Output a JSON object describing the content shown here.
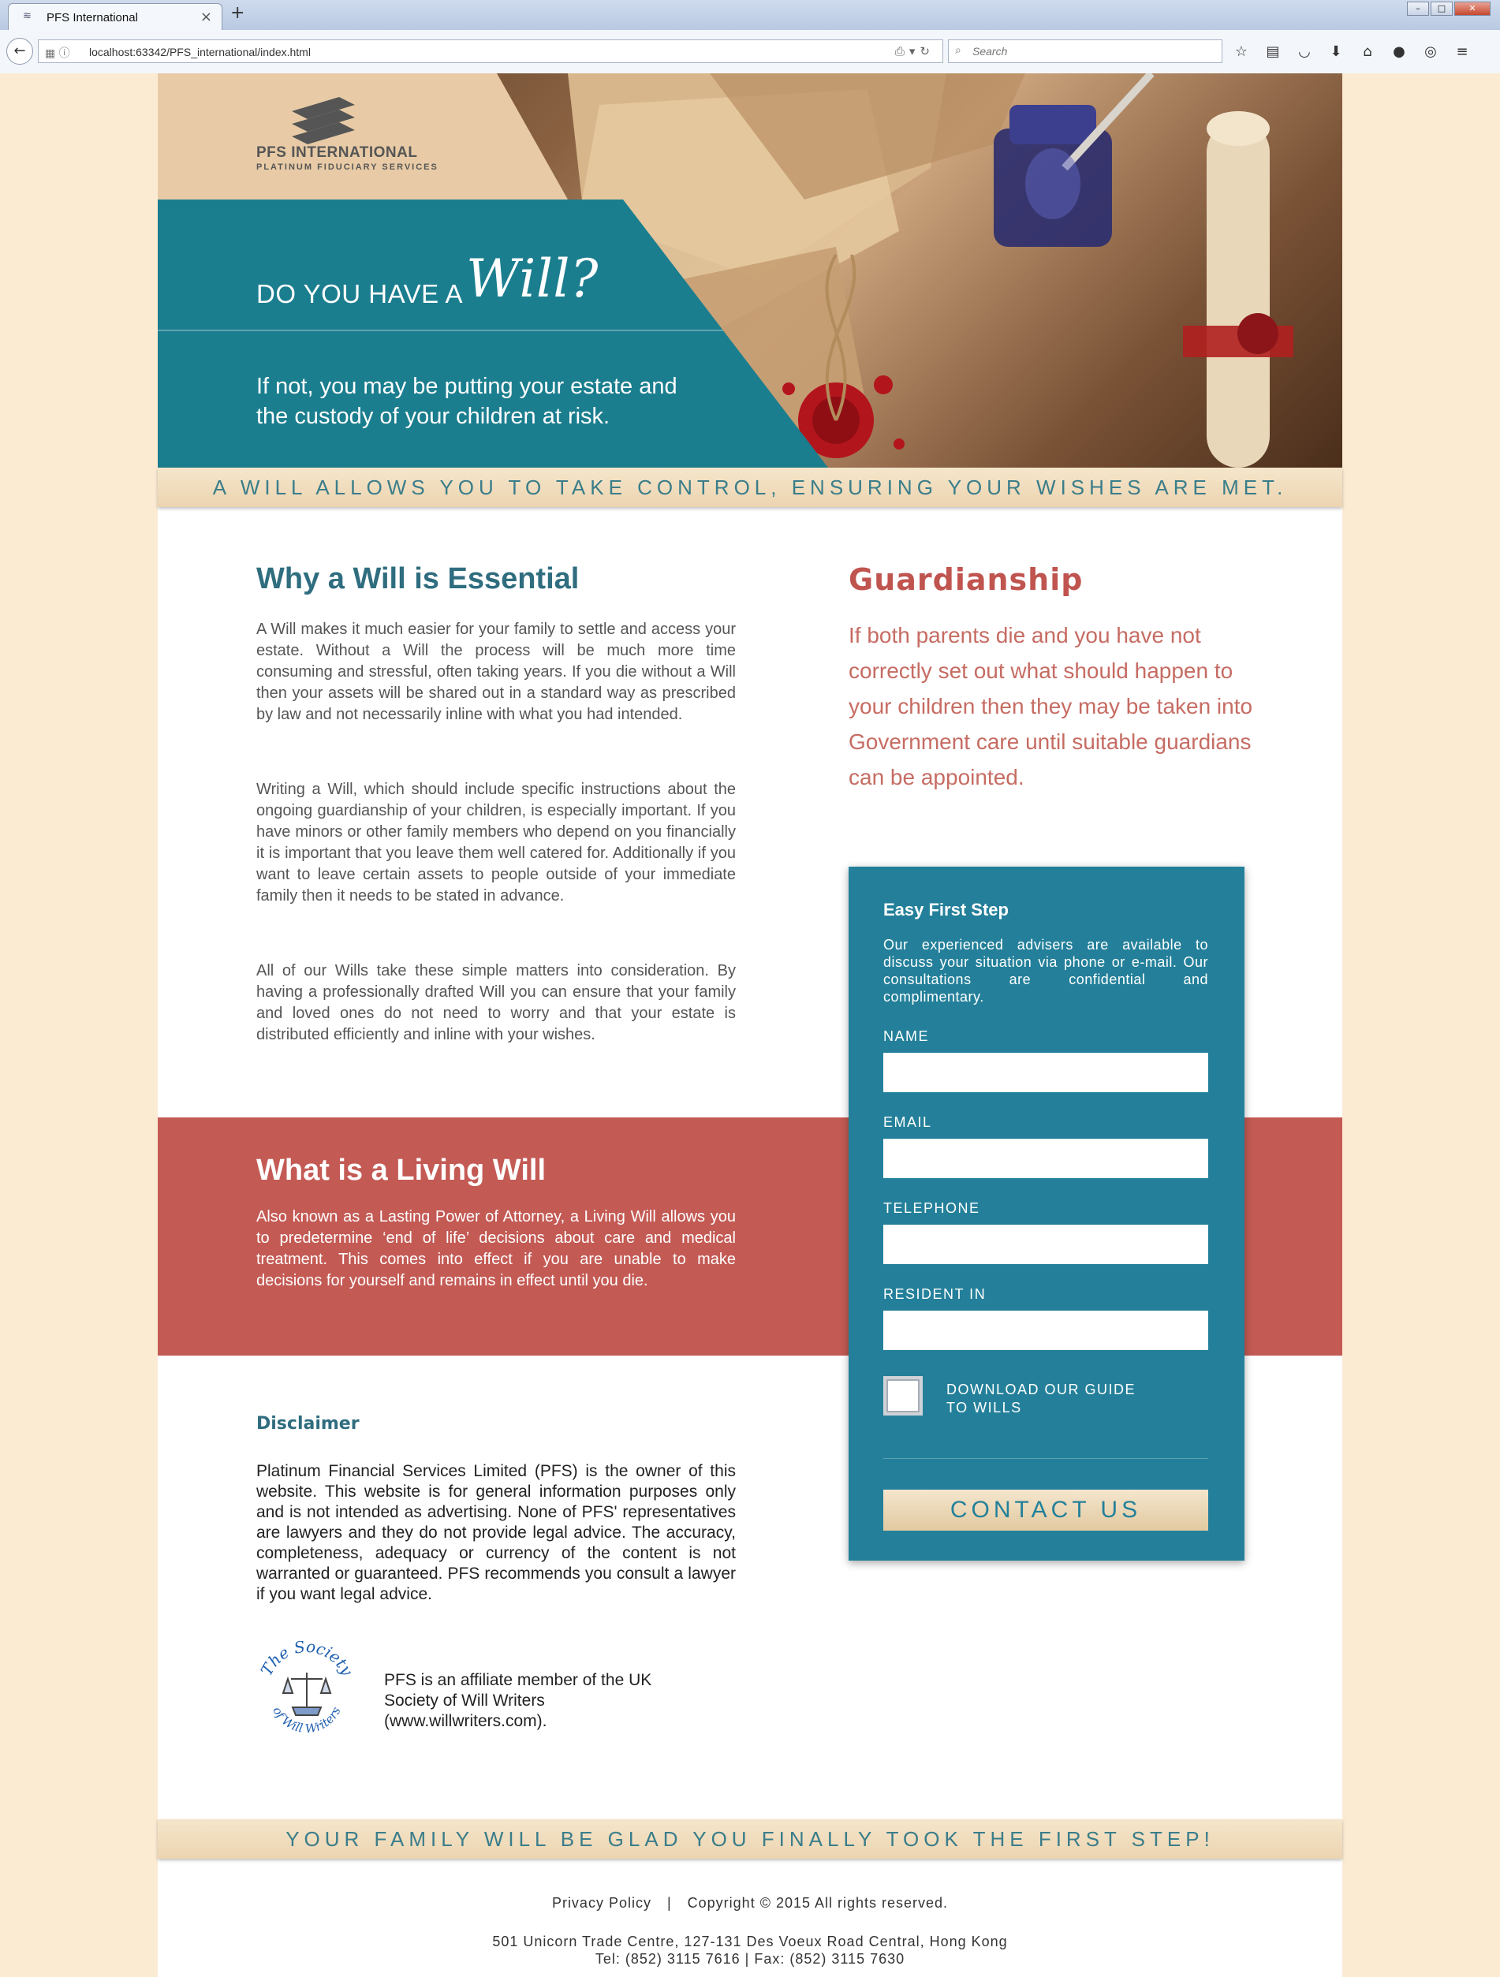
{
  "browser": {
    "tab_title": "PFS International",
    "url": "localhost:63342/PFS_international/index.html",
    "search_placeholder": "Search"
  },
  "hero": {
    "logo_line1": "PFS INTERNATIONAL",
    "logo_line2": "PLATINUM FIDUCIARY SERVICES",
    "question_prefix": "DO YOU HAVE A",
    "question_word": "Will?",
    "subtitle": "If not, you may be putting your estate and the custody of your children at risk."
  },
  "ribbon_top": "A WILL ALLOWS YOU TO TAKE CONTROL, ENSURING YOUR WISHES ARE MET.",
  "why": {
    "title": "Why a Will is Essential",
    "p1": "A Will makes it much easier for your family to settle and access your estate. Without a Will the process will be much more time consuming and stressful, often taking years. If you die without a Will then your assets will be shared out in a standard way as prescribed by law and not necessarily inline with what you had intended.",
    "p2": "Writing a Will, which should include specific instructions about the ongoing guardianship of your children, is especially important. If you have minors or other family members who depend on you financially it is important that you leave them well catered for. Additionally if you want to leave certain assets to people outside of your immediate family then it needs to be stated in advance.",
    "p3": "All of our Wills take these simple matters into consideration. By having a professionally drafted Will you can ensure that your family and loved ones do not need to worry and that your estate is distributed efficiently and inline with your wishes."
  },
  "guardianship": {
    "title": "Guardianship",
    "text": "If both parents die and you have not correctly set out what should happen to your children then they may be taken into Government care until suitable guardians can be appointed."
  },
  "living_will": {
    "title": "What is a Living Will",
    "text": "Also known as a Lasting Power of Attorney, a Living Will allows you to predetermine ‘end of life’ decisions about care and medical treatment. This comes into effect if you are unable to make decisions for yourself and remains in effect until you die."
  },
  "disclaimer": {
    "title": "Disclaimer",
    "text": "Platinum Financial Services Limited (PFS) is the owner of this website. This website is for general information purposes only and is not intended as advertising. None of PFS' representatives are lawyers and they do not provide legal advice. The accuracy, completeness, adequacy or currency of the content is not warranted or guaranteed. PFS recommends you consult a lawyer if you want legal advice."
  },
  "society": {
    "logo_text_top": "The Society",
    "logo_text_bottom": "of Will Writers",
    "text": "PFS is an affiliate member of the UK Society of Will Writers (www.willwriters.com)."
  },
  "form": {
    "title": "Easy First Step",
    "intro": "Our experienced advisers are available to discuss your situation via phone or e-mail. Our consultations are confidential and complimentary.",
    "name_label": "NAME",
    "email_label": "EMAIL",
    "telephone_label": "TELEPHONE",
    "resident_label": "RESIDENT IN",
    "name_value": "",
    "email_value": "",
    "telephone_value": "",
    "resident_value": "",
    "checkbox_label": "DOWNLOAD OUR GUIDE TO WILLS",
    "checkbox_checked": false,
    "submit_label": "CONTACT US"
  },
  "ribbon_bottom": "YOUR FAMILY WILL BE GLAD YOU FINALLY TOOK THE FIRST STEP!",
  "footer": {
    "privacy_label": "Privacy Policy",
    "separator": "|",
    "copyright": "Copyright © 2015 All rights reserved.",
    "address": "501 Unicorn Trade Centre, 127-131 Des Voeux Road Central, Hong Kong",
    "contact": "Tel: (852) 3115 7616 | Fax: (852) 3115 7630"
  },
  "colors": {
    "page_background": "#fcebd3",
    "teal": "#24809a",
    "heading_teal": "#2f6d7f",
    "red_band": "#c45a54",
    "guardianship_red": "#c0544f",
    "ribbon_beige": "#f2e1c2"
  }
}
